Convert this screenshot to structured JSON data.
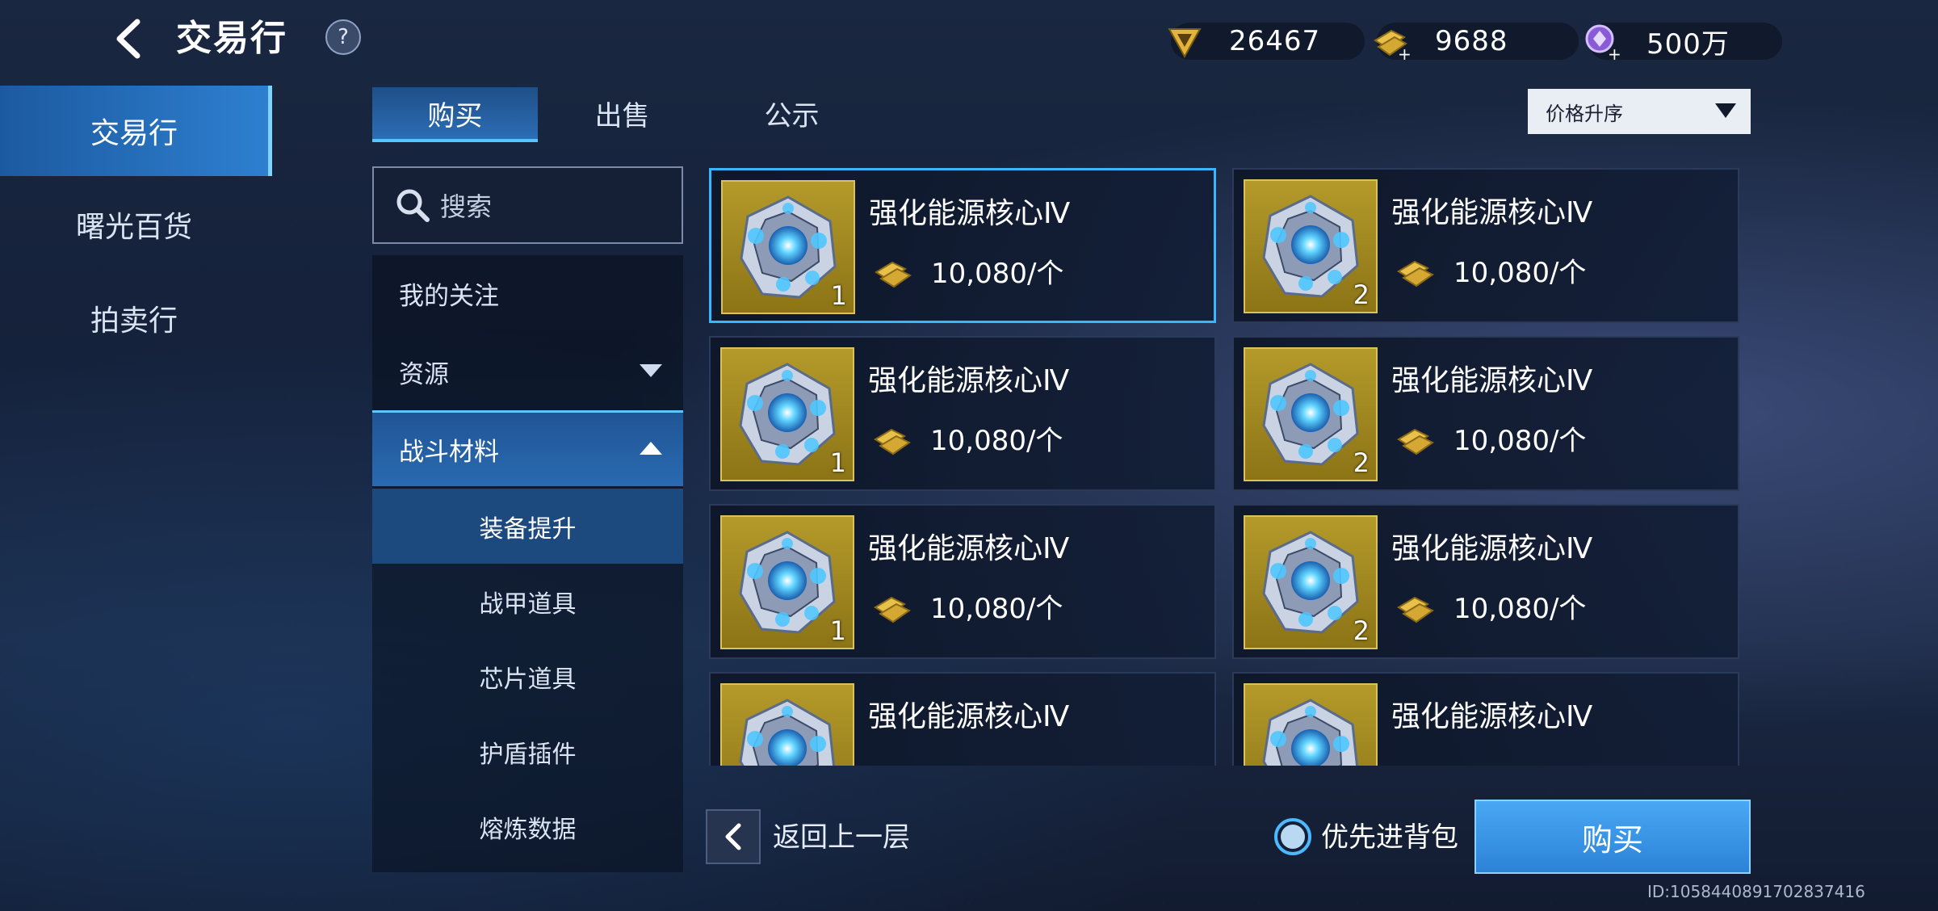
{
  "header": {
    "title": "交易行",
    "help_label": "?",
    "currencies": [
      {
        "icon": "gold-triangle-token-icon",
        "value": "26467"
      },
      {
        "icon": "gold-bar-plus-icon",
        "value": "9688"
      },
      {
        "icon": "purple-crystal-plus-icon",
        "value": "500万"
      }
    ]
  },
  "nav": {
    "items": [
      {
        "label": "交易行",
        "active": true
      },
      {
        "label": "曙光百货",
        "active": false
      },
      {
        "label": "拍卖行",
        "active": false
      }
    ]
  },
  "tabs": [
    {
      "label": "购买",
      "active": true
    },
    {
      "label": "出售",
      "active": false
    },
    {
      "label": "公示",
      "active": false
    }
  ],
  "sort": {
    "selected": "价格升序"
  },
  "search": {
    "placeholder": "搜索"
  },
  "categories": {
    "favorites": "我的关注",
    "resources": "资源",
    "combat_materials": "战斗材料",
    "sub_items": [
      "装备提升",
      "战甲道具",
      "芯片道具",
      "护盾插件",
      "熔炼数据"
    ],
    "active_sub": "装备提升"
  },
  "listings": [
    {
      "name": "强化能源核心Ⅳ",
      "qty": "1",
      "price": "10,080/个",
      "selected": true
    },
    {
      "name": "强化能源核心Ⅳ",
      "qty": "2",
      "price": "10,080/个",
      "selected": false
    },
    {
      "name": "强化能源核心Ⅳ",
      "qty": "1",
      "price": "10,080/个",
      "selected": false
    },
    {
      "name": "强化能源核心Ⅳ",
      "qty": "2",
      "price": "10,080/个",
      "selected": false
    },
    {
      "name": "强化能源核心Ⅳ",
      "qty": "1",
      "price": "10,080/个",
      "selected": false
    },
    {
      "name": "强化能源核心Ⅳ",
      "qty": "2",
      "price": "10,080/个",
      "selected": false
    },
    {
      "name": "强化能源核心Ⅳ",
      "qty": "",
      "price": "",
      "selected": false
    },
    {
      "name": "强化能源核心Ⅳ",
      "qty": "",
      "price": "",
      "selected": false
    }
  ],
  "footer": {
    "back_label": "返回上一层",
    "priority_bag_label": "优先进背包",
    "buy_label": "购买",
    "uid": "ID:1058440891702837416"
  },
  "colors": {
    "accent": "#3ab6ff",
    "buy_button": "#3a95e6",
    "item_frame_gold": "#b49a2a"
  }
}
